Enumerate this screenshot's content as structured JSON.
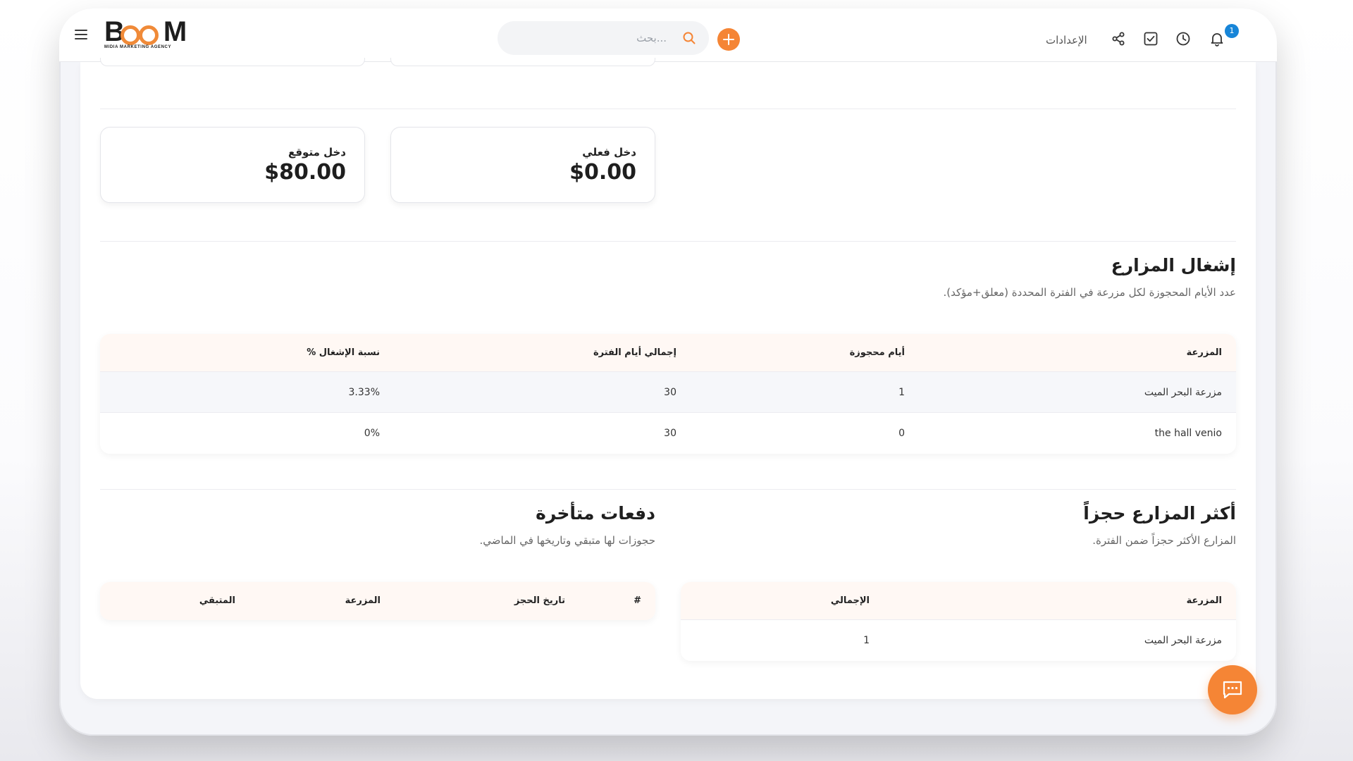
{
  "brand": {
    "name": "BOOM",
    "tagline": "MIDIA MARKETING AGENCY",
    "accent": "#f58535"
  },
  "header": {
    "search_placeholder": "...بحث",
    "settings_label": "الإعدادات",
    "notifications_count": "1"
  },
  "stats": {
    "expected_label": "دخل متوقع",
    "expected_value": "$80.00",
    "actual_label": "دخل فعلي",
    "actual_value": "$0.00"
  },
  "occupancy": {
    "title": "إشغال المزارع",
    "subtitle": "عدد الأيام المحجوزة لكل مزرعة في الفترة المحددة (معلق+مؤكد).",
    "columns": [
      "المزرعة",
      "أيام محجوزة",
      "إجمالي أيام الفترة",
      "نسبة الإشغال %"
    ],
    "rows": [
      [
        "مزرعة البحر الميت",
        "1",
        "30",
        "3.33%"
      ],
      [
        "the hall venio",
        "0",
        "30",
        "0%"
      ]
    ]
  },
  "top_farms": {
    "title": "أكثر المزارع حجزاً",
    "subtitle": "المزارع الأكثر حجزاً ضمن الفترة.",
    "columns": [
      "المزرعة",
      "الإجمالي"
    ],
    "rows": [
      [
        "مزرعة البحر الميت",
        "1"
      ]
    ]
  },
  "late_payments": {
    "title": "دفعات متأخرة",
    "subtitle": "حجوزات لها متبقي وتاريخها في الماضي.",
    "columns": [
      "#",
      "تاريخ الحجز",
      "المزرعة",
      "المتبقي"
    ]
  }
}
